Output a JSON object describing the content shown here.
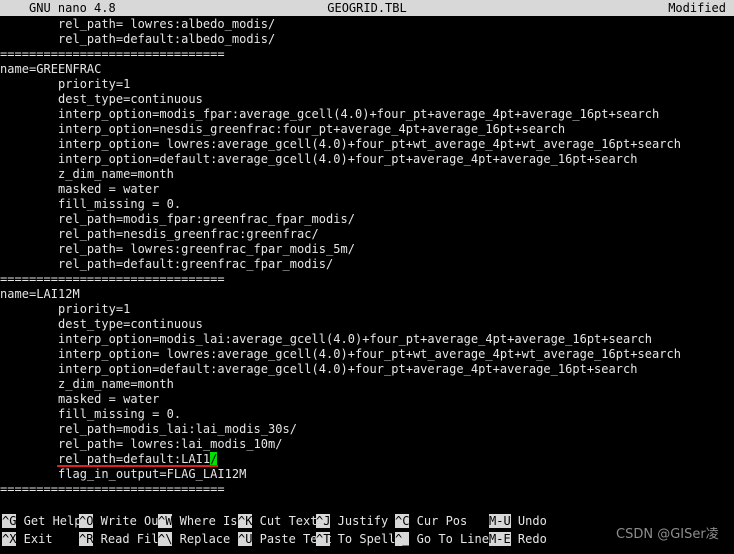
{
  "titlebar": {
    "version": "GNU nano 4.8",
    "filename": "GEOGRID.TBL",
    "state": "Modified"
  },
  "editor": {
    "lines": [
      "        rel_path= lowres:albedo_modis/",
      "        rel_path=default:albedo_modis/",
      "===============================",
      "name=GREENFRAC",
      "        priority=1",
      "        dest_type=continuous",
      "        interp_option=modis_fpar:average_gcell(4.0)+four_pt+average_4pt+average_16pt+search",
      "        interp_option=nesdis_greenfrac:four_pt+average_4pt+average_16pt+search",
      "        interp_option= lowres:average_gcell(4.0)+four_pt+wt_average_4pt+wt_average_16pt+search",
      "        interp_option=default:average_gcell(4.0)+four_pt+average_4pt+average_16pt+search",
      "        z_dim_name=month",
      "        masked = water",
      "        fill_missing = 0.",
      "        rel_path=modis_fpar:greenfrac_fpar_modis/",
      "        rel_path=nesdis_greenfrac:greenfrac/",
      "        rel_path= lowres:greenfrac_fpar_modis_5m/",
      "        rel_path=default:greenfrac_fpar_modis/",
      "===============================",
      "name=LAI12M",
      "        priority=1",
      "        dest_type=continuous",
      "        interp_option=modis_lai:average_gcell(4.0)+four_pt+average_4pt+average_16pt+search",
      "        interp_option= lowres:average_gcell(4.0)+four_pt+wt_average_4pt+wt_average_16pt+search",
      "        interp_option=default:average_gcell(4.0)+four_pt+average_4pt+average_16pt+search",
      "        z_dim_name=month",
      "        masked = water",
      "        fill_missing = 0.",
      "        rel_path=modis_lai:lai_modis_30s/",
      "        rel_path= lowres:lai_modis_10m/",
      "",
      "        flag_in_output=FLAG_LAI12M",
      "===============================",
      "",
      ""
    ],
    "cursor_line": {
      "index": 29,
      "before_cursor": "        rel_path=default:LAI1",
      "cursor_char": "/",
      "after_cursor": ""
    },
    "annotation": {
      "type": "red-underline",
      "color": "#e02020"
    },
    "cursor_color": "#00e000"
  },
  "helpbar": {
    "shortcuts": [
      {
        "key": "^G",
        "label": "Get Help",
        "col": 0,
        "row": 0
      },
      {
        "key": "^X",
        "label": "Exit",
        "col": 0,
        "row": 1
      },
      {
        "key": "^O",
        "label": "Write Out",
        "col": 1,
        "row": 0
      },
      {
        "key": "^R",
        "label": "Read File",
        "col": 1,
        "row": 1
      },
      {
        "key": "^W",
        "label": "Where Is",
        "col": 2,
        "row": 0
      },
      {
        "key": "^\\",
        "label": "Replace",
        "col": 2,
        "row": 1
      },
      {
        "key": "^K",
        "label": "Cut Text",
        "col": 3,
        "row": 0
      },
      {
        "key": "^U",
        "label": "Paste Text",
        "col": 3,
        "row": 1
      },
      {
        "key": "^J",
        "label": "Justify",
        "col": 4,
        "row": 0
      },
      {
        "key": "^T",
        "label": "To Spell",
        "col": 4,
        "row": 1
      },
      {
        "key": "^C",
        "label": "Cur Pos",
        "col": 5,
        "row": 0
      },
      {
        "key": "^_",
        "label": "Go To Line",
        "col": 5,
        "row": 1
      },
      {
        "key": "M-U",
        "label": "Undo",
        "col": 6,
        "row": 0
      },
      {
        "key": "M-E",
        "label": "Redo",
        "col": 6,
        "row": 1
      }
    ]
  },
  "watermark": {
    "text": "CSDN @GISer凌"
  }
}
